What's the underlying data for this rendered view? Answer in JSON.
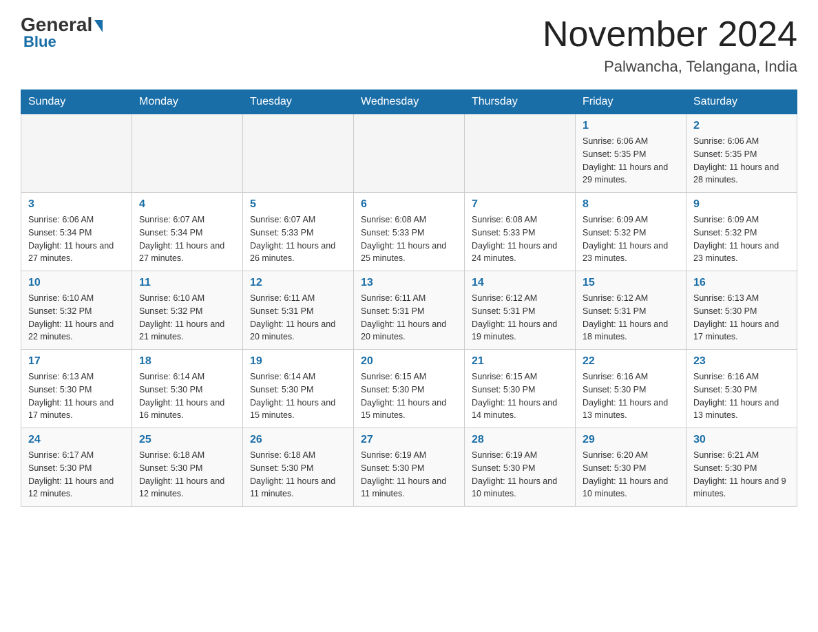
{
  "header": {
    "logo_general": "General",
    "logo_blue": "Blue",
    "month_year": "November 2024",
    "location": "Palwancha, Telangana, India"
  },
  "days_of_week": [
    "Sunday",
    "Monday",
    "Tuesday",
    "Wednesday",
    "Thursday",
    "Friday",
    "Saturday"
  ],
  "weeks": [
    [
      {
        "day": "",
        "info": ""
      },
      {
        "day": "",
        "info": ""
      },
      {
        "day": "",
        "info": ""
      },
      {
        "day": "",
        "info": ""
      },
      {
        "day": "",
        "info": ""
      },
      {
        "day": "1",
        "info": "Sunrise: 6:06 AM\nSunset: 5:35 PM\nDaylight: 11 hours and 29 minutes."
      },
      {
        "day": "2",
        "info": "Sunrise: 6:06 AM\nSunset: 5:35 PM\nDaylight: 11 hours and 28 minutes."
      }
    ],
    [
      {
        "day": "3",
        "info": "Sunrise: 6:06 AM\nSunset: 5:34 PM\nDaylight: 11 hours and 27 minutes."
      },
      {
        "day": "4",
        "info": "Sunrise: 6:07 AM\nSunset: 5:34 PM\nDaylight: 11 hours and 27 minutes."
      },
      {
        "day": "5",
        "info": "Sunrise: 6:07 AM\nSunset: 5:33 PM\nDaylight: 11 hours and 26 minutes."
      },
      {
        "day": "6",
        "info": "Sunrise: 6:08 AM\nSunset: 5:33 PM\nDaylight: 11 hours and 25 minutes."
      },
      {
        "day": "7",
        "info": "Sunrise: 6:08 AM\nSunset: 5:33 PM\nDaylight: 11 hours and 24 minutes."
      },
      {
        "day": "8",
        "info": "Sunrise: 6:09 AM\nSunset: 5:32 PM\nDaylight: 11 hours and 23 minutes."
      },
      {
        "day": "9",
        "info": "Sunrise: 6:09 AM\nSunset: 5:32 PM\nDaylight: 11 hours and 23 minutes."
      }
    ],
    [
      {
        "day": "10",
        "info": "Sunrise: 6:10 AM\nSunset: 5:32 PM\nDaylight: 11 hours and 22 minutes."
      },
      {
        "day": "11",
        "info": "Sunrise: 6:10 AM\nSunset: 5:32 PM\nDaylight: 11 hours and 21 minutes."
      },
      {
        "day": "12",
        "info": "Sunrise: 6:11 AM\nSunset: 5:31 PM\nDaylight: 11 hours and 20 minutes."
      },
      {
        "day": "13",
        "info": "Sunrise: 6:11 AM\nSunset: 5:31 PM\nDaylight: 11 hours and 20 minutes."
      },
      {
        "day": "14",
        "info": "Sunrise: 6:12 AM\nSunset: 5:31 PM\nDaylight: 11 hours and 19 minutes."
      },
      {
        "day": "15",
        "info": "Sunrise: 6:12 AM\nSunset: 5:31 PM\nDaylight: 11 hours and 18 minutes."
      },
      {
        "day": "16",
        "info": "Sunrise: 6:13 AM\nSunset: 5:30 PM\nDaylight: 11 hours and 17 minutes."
      }
    ],
    [
      {
        "day": "17",
        "info": "Sunrise: 6:13 AM\nSunset: 5:30 PM\nDaylight: 11 hours and 17 minutes."
      },
      {
        "day": "18",
        "info": "Sunrise: 6:14 AM\nSunset: 5:30 PM\nDaylight: 11 hours and 16 minutes."
      },
      {
        "day": "19",
        "info": "Sunrise: 6:14 AM\nSunset: 5:30 PM\nDaylight: 11 hours and 15 minutes."
      },
      {
        "day": "20",
        "info": "Sunrise: 6:15 AM\nSunset: 5:30 PM\nDaylight: 11 hours and 15 minutes."
      },
      {
        "day": "21",
        "info": "Sunrise: 6:15 AM\nSunset: 5:30 PM\nDaylight: 11 hours and 14 minutes."
      },
      {
        "day": "22",
        "info": "Sunrise: 6:16 AM\nSunset: 5:30 PM\nDaylight: 11 hours and 13 minutes."
      },
      {
        "day": "23",
        "info": "Sunrise: 6:16 AM\nSunset: 5:30 PM\nDaylight: 11 hours and 13 minutes."
      }
    ],
    [
      {
        "day": "24",
        "info": "Sunrise: 6:17 AM\nSunset: 5:30 PM\nDaylight: 11 hours and 12 minutes."
      },
      {
        "day": "25",
        "info": "Sunrise: 6:18 AM\nSunset: 5:30 PM\nDaylight: 11 hours and 12 minutes."
      },
      {
        "day": "26",
        "info": "Sunrise: 6:18 AM\nSunset: 5:30 PM\nDaylight: 11 hours and 11 minutes."
      },
      {
        "day": "27",
        "info": "Sunrise: 6:19 AM\nSunset: 5:30 PM\nDaylight: 11 hours and 11 minutes."
      },
      {
        "day": "28",
        "info": "Sunrise: 6:19 AM\nSunset: 5:30 PM\nDaylight: 11 hours and 10 minutes."
      },
      {
        "day": "29",
        "info": "Sunrise: 6:20 AM\nSunset: 5:30 PM\nDaylight: 11 hours and 10 minutes."
      },
      {
        "day": "30",
        "info": "Sunrise: 6:21 AM\nSunset: 5:30 PM\nDaylight: 11 hours and 9 minutes."
      }
    ]
  ]
}
